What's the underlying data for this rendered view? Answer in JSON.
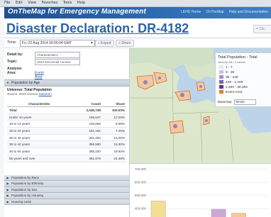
{
  "menubar": [
    "File",
    "Edit",
    "View",
    "Favorites",
    "Tools",
    "Help"
  ],
  "app": {
    "name": "OnTheMap for Emergency Management",
    "top_links": [
      "LEHD Home",
      "OnTheMap",
      "Help and Documentation"
    ]
  },
  "page": {
    "title": "Disaster Declaration: DR-4182",
    "close_label": "× Clo"
  },
  "toolbar": {
    "time_label": "Time:",
    "time_value": "Fri, 22 Aug 2014 00:00:04 GMT",
    "export_label": "» Export",
    "share_label": "» Share"
  },
  "detail": {
    "detail_label": "Detail by:",
    "detail_value": "Characteristics",
    "topic_label": "Topic:",
    "topic_value": "2010 Decennial Census",
    "area_label": "Analysis Area:",
    "area_link": "Event Area"
  },
  "section": {
    "header": "Population by Age",
    "universe_title": "Universe: Total Population",
    "universe_source_prefix": "Source: 2010 Census ",
    "universe_source_link": "Data/Info"
  },
  "table": {
    "headers": [
      "Characteristic",
      "Count",
      "Share"
    ],
    "total": {
      "label": "Total",
      "count": "2,035,738",
      "share": "100.00%"
    },
    "rows": [
      {
        "label": "Under 10 years",
        "count": "248,547",
        "share": "12.20%"
      },
      {
        "label": "10 to 14 years",
        "count": "116,665",
        "share": "5.68%"
      },
      {
        "label": "15 to 24 years",
        "count": "161,181",
        "share": "7.25%"
      },
      {
        "label": "25 to 34 years",
        "count": "301,294",
        "share": "15.05%"
      },
      {
        "label": "35 to 44 years",
        "count": "356,590",
        "share": "16.30%"
      },
      {
        "label": "45 to 54 years",
        "count": "388,220",
        "share": "18.82%"
      },
      {
        "label": "55 years and over",
        "count": "461,978",
        "share": "22.39%"
      }
    ]
  },
  "collapsed_sections": [
    "Population by Race",
    "Population by Ethnicity",
    "Population by Sex",
    "Population by Housing",
    "Housing Units"
  ],
  "legend": {
    "title": "Total Population - Total",
    "subtitle": "Jobs by: All / 2 Labels",
    "items": [
      {
        "label": "1 - 7",
        "color": "#e8e6f3"
      },
      {
        "label": "8 - 36",
        "color": "#c6c0e0"
      },
      {
        "label": "36 - 448",
        "color": "#9c92c9"
      },
      {
        "label": "449 - 1,448",
        "color": "#7564b0"
      },
      {
        "label": "1,450 - 38,384",
        "color": "#4e3d92"
      },
      {
        "label": "Event Area",
        "color": "#f07a2e"
      }
    ],
    "basemap_label": "Basemap:",
    "basemap_value": "Terrain"
  },
  "chart_data": {
    "type": "bar",
    "title": "",
    "categories": [
      "",
      "",
      "",
      "",
      "",
      ""
    ],
    "values": [
      458000,
      190000,
      205000,
      395000,
      365000,
      325000
    ],
    "colors": [
      "#f3df94",
      "#c9d9f1",
      "#a6d88f",
      "#cfa7d6",
      "#f7c98c",
      "#f3df94"
    ],
    "ytick_labels": [
      "700,000",
      "600,000",
      "500,000",
      "400,000"
    ],
    "ylim": [
      330000,
      720000
    ],
    "xlabel": "",
    "ylabel": "",
    "grid": true,
    "legend": "none"
  }
}
